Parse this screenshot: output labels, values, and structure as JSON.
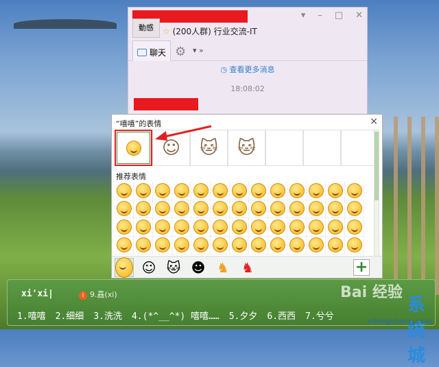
{
  "chat_window": {
    "group_title": "(200人群) 行业交流-IT",
    "avatar_text": "動感",
    "tab_chat": "聊天",
    "more_icon": "»",
    "view_more": "查看更多消息",
    "timestamp": "18:08:02"
  },
  "emoji_panel": {
    "title": "“嘻嘻”的表情",
    "close": "×",
    "recommended_label": "推荐表情",
    "grid_rows": 4,
    "grid_cols": 13,
    "add_button": "+"
  },
  "ime": {
    "pinyin": "xi'xi|",
    "hint": "9.嚞(xi)",
    "candidates": [
      "1.嘻嘻",
      "2.细细",
      "3.洗洗",
      "4.(*^__^*) 嘻嘻……",
      "5.夕夕",
      "6.西西",
      "7.兮兮"
    ]
  },
  "watermark": {
    "baidu": "Bai 经验",
    "site": "系统城",
    "url": "xitongcheng.com"
  },
  "colors": {
    "redaction": "#e8191f",
    "ime_green": "#4f8a3c",
    "accent_blue": "#2f7fd0"
  }
}
